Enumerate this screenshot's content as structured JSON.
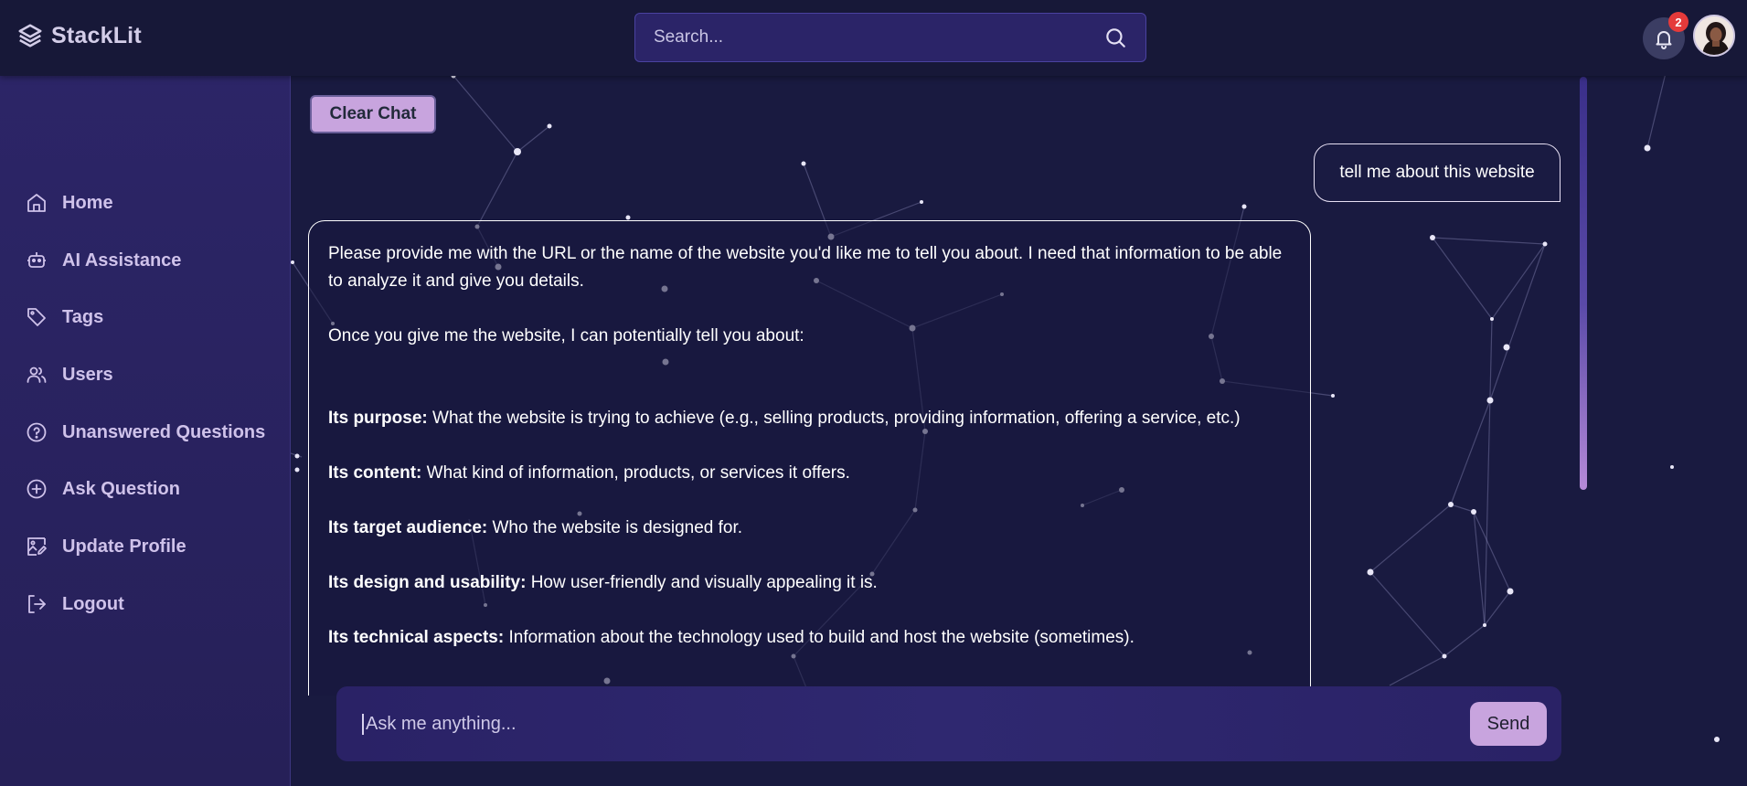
{
  "brand": {
    "name": "StackLit"
  },
  "search": {
    "placeholder": "Search..."
  },
  "notifications": {
    "count": "2"
  },
  "sidebar": {
    "items": [
      {
        "label": "Home",
        "icon": "home-icon"
      },
      {
        "label": "AI Assistance",
        "icon": "robot-icon"
      },
      {
        "label": "Tags",
        "icon": "tag-icon"
      },
      {
        "label": "Users",
        "icon": "users-icon"
      },
      {
        "label": "Unanswered Questions",
        "icon": "question-circle-icon"
      },
      {
        "label": "Ask Question",
        "icon": "plus-circle-icon"
      },
      {
        "label": "Update Profile",
        "icon": "image-edit-icon"
      },
      {
        "label": "Logout",
        "icon": "logout-icon"
      }
    ]
  },
  "chat": {
    "clear_label": "Clear Chat",
    "user_message": "tell me about this website",
    "bot": {
      "intro": "Please provide me with the URL or the name of the website you'd like me to tell you about. I need that information to be able to analyze it and give you details.",
      "lead": "Once you give me the website, I can potentially tell you about:",
      "points": [
        {
          "title": "Its purpose:",
          "text": " What the website is trying to achieve (e.g., selling products, providing information, offering a service, etc.)"
        },
        {
          "title": "Its content:",
          "text": " What kind of information, products, or services it offers."
        },
        {
          "title": "Its target audience:",
          "text": " Who the website is designed for."
        },
        {
          "title": "Its design and usability:",
          "text": " How user-friendly and visually appealing it is."
        },
        {
          "title": "Its technical aspects:",
          "text": " Information about the technology used to build and host the website (sometimes)."
        }
      ]
    }
  },
  "composer": {
    "placeholder": "Ask me anything...",
    "send_label": "Send"
  },
  "colors": {
    "background": "#191a40",
    "sidebar": "#2c2567",
    "accent_button": "#c8a4de",
    "badge": "#e53a3a"
  }
}
